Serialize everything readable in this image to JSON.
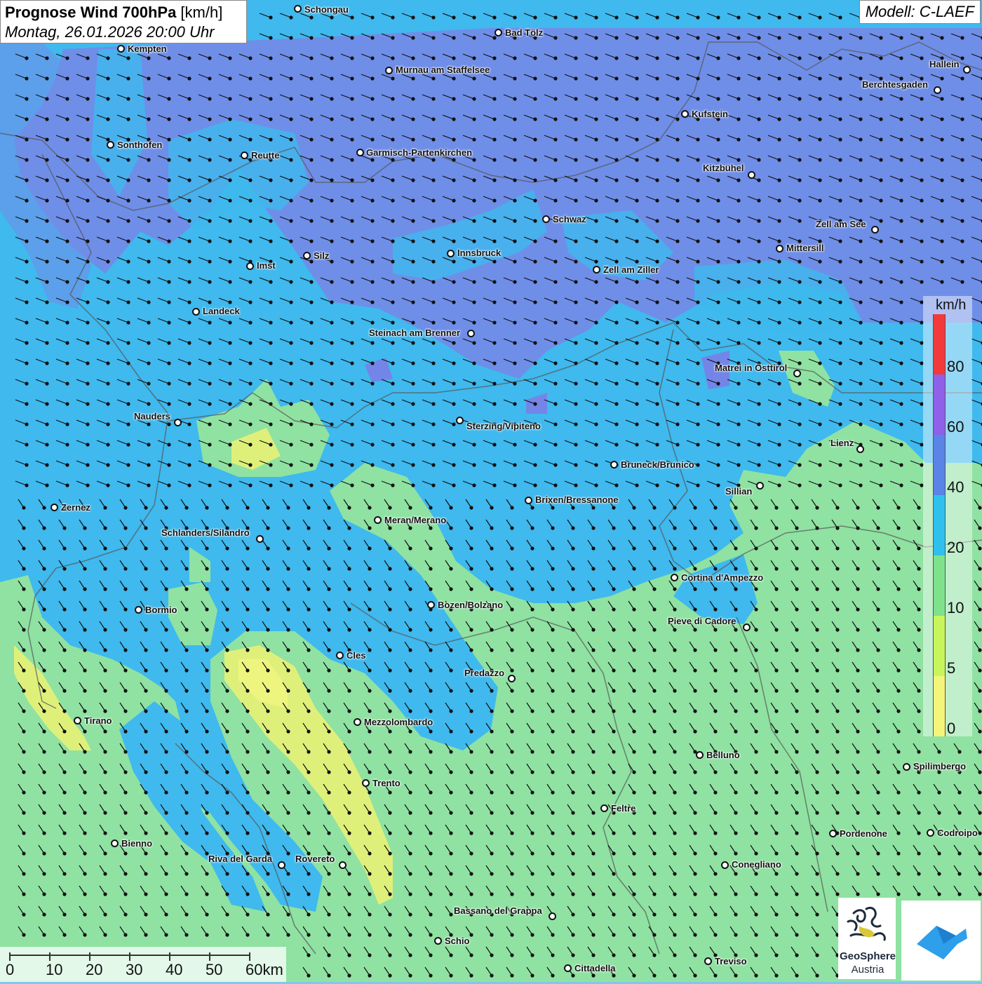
{
  "title": {
    "main_bold": "Prognose Wind 700hPa",
    "main_unit": " [km/h]",
    "datetime": "Montag, 26.01.2026 20:00 Uhr"
  },
  "model": "Modell: C-LAEF",
  "legend": {
    "unit": "km/h",
    "bands": [
      {
        "label": "0",
        "color": "#f3f57a"
      },
      {
        "label": "5",
        "color": "#c9f55c"
      },
      {
        "label": "10",
        "color": "#7ee28c"
      },
      {
        "label": "20",
        "color": "#2fc0ee"
      },
      {
        "label": "40",
        "color": "#5a84e6"
      },
      {
        "label": "60",
        "color": "#8f60e8"
      },
      {
        "label": "80",
        "color": "#f23a3a"
      }
    ],
    "labels": [
      "0",
      "5",
      "10",
      "20",
      "40",
      "60",
      "80"
    ]
  },
  "scale": {
    "labels": [
      "0",
      "10",
      "20",
      "30",
      "40",
      "50",
      "60km"
    ]
  },
  "logos": {
    "geosphere_name": "GeoSphere",
    "geosphere_sub": "Austria"
  },
  "cities": [
    {
      "name": "Schongau"
    },
    {
      "name": "Bad Tölz"
    },
    {
      "name": "Kempten"
    },
    {
      "name": "Murnau am Staffelsee"
    },
    {
      "name": "Hallein"
    },
    {
      "name": "Berchtesgaden"
    },
    {
      "name": "Kufstein"
    },
    {
      "name": "Sonthofen"
    },
    {
      "name": "Reutte"
    },
    {
      "name": "Garmisch-Partenkirchen"
    },
    {
      "name": "Kitzbühel"
    },
    {
      "name": "Schwaz"
    },
    {
      "name": "Zell am See"
    },
    {
      "name": "Mittersill"
    },
    {
      "name": "Innsbruck"
    },
    {
      "name": "Silz"
    },
    {
      "name": "Imst"
    },
    {
      "name": "Zell am Ziller"
    },
    {
      "name": "Landeck"
    },
    {
      "name": "Steinach am Brenner"
    },
    {
      "name": "Matrei in Osttirol"
    },
    {
      "name": "Nauders"
    },
    {
      "name": "Sterzing/Vipiteno"
    },
    {
      "name": "Lienz"
    },
    {
      "name": "Bruneck/Brunico"
    },
    {
      "name": "Sillian"
    },
    {
      "name": "Brixen/Bressanone"
    },
    {
      "name": "Zernez"
    },
    {
      "name": "Meran/Merano"
    },
    {
      "name": "Schlanders/Silandro"
    },
    {
      "name": "Cortina d'Ampezzo"
    },
    {
      "name": "Bozen/Bolzano"
    },
    {
      "name": "Bormio"
    },
    {
      "name": "Pieve di Cadore"
    },
    {
      "name": "Cles"
    },
    {
      "name": "Predazzo"
    },
    {
      "name": "Tirano"
    },
    {
      "name": "Mezzolombardo"
    },
    {
      "name": "Belluno"
    },
    {
      "name": "Spilimbergo"
    },
    {
      "name": "Trento"
    },
    {
      "name": "Feltre"
    },
    {
      "name": "Pordenone"
    },
    {
      "name": "Codroipo"
    },
    {
      "name": "Bienno"
    },
    {
      "name": "Riva del Garda"
    },
    {
      "name": "Rovereto"
    },
    {
      "name": "Conegliano"
    },
    {
      "name": "Bassano del Grappa"
    },
    {
      "name": "Schio"
    },
    {
      "name": "Treviso"
    },
    {
      "name": "Cittadella"
    }
  ]
}
